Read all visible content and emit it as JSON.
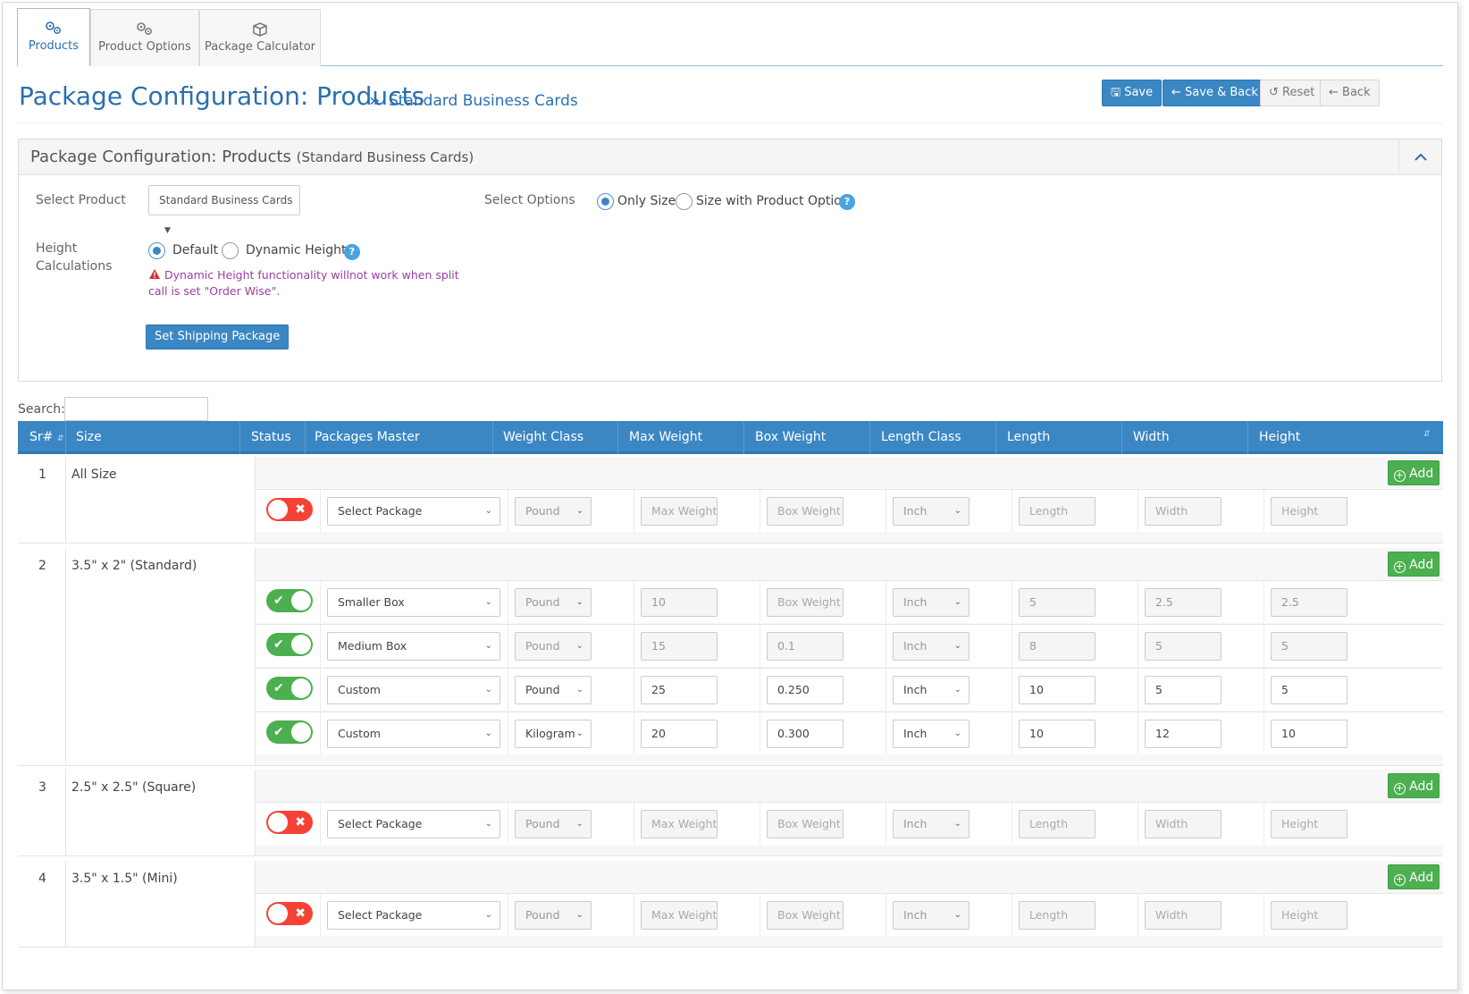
{
  "tabs": [
    {
      "label": "Products",
      "icon": "gears-icon",
      "active": true
    },
    {
      "label": "Product Options",
      "icon": "gears-icon",
      "active": false
    },
    {
      "label": "Package Calculator",
      "icon": "box-icon",
      "active": false
    }
  ],
  "header": {
    "title": "Package Configuration: Products",
    "breadcrumb_sep": "»",
    "breadcrumb": "Standard Business Cards",
    "buttons": {
      "save": "Save",
      "save_back": "Save & Back",
      "reset": "Reset",
      "back": "Back"
    }
  },
  "panel": {
    "title": "Package Configuration: Products",
    "subtitle": "(Standard Business Cards)",
    "select_product_label": "Select Product",
    "select_product_value": "Standard Business Cards",
    "select_options_label": "Select Options",
    "option_only_size": "Only Size",
    "option_size_with_product": "Size with Product Option",
    "height_calc_label_1": "Height",
    "height_calc_label_2": "Calculations",
    "height_default": "Default",
    "height_dynamic": "Dynamic Height",
    "warning_line_1": "Dynamic Height functionality willnot work when split",
    "warning_line_2": "call is set \"Order Wise\".",
    "set_shipping_button": "Set Shipping Package",
    "help": "?"
  },
  "search": {
    "label": "Search:"
  },
  "table": {
    "columns": [
      "Sr#",
      "Size",
      "Status",
      "Packages Master",
      "Weight Class",
      "Max Weight",
      "Box Weight",
      "Length Class",
      "Length",
      "Width",
      "Height"
    ],
    "add_label": "Add",
    "groups": [
      {
        "sr": "1",
        "size": "All Size",
        "rows": [
          {
            "status": "off",
            "package": "Select Package",
            "weight_class": "Pound",
            "max_weight": "Max Weight",
            "box_weight": "Box Weight",
            "length_class": "Inch",
            "length": "Length",
            "width": "Width",
            "height": "Height"
          }
        ]
      },
      {
        "sr": "2",
        "size": "3.5\" x 2\" (Standard)",
        "rows": [
          {
            "status": "on",
            "package": "Smaller Box",
            "weight_class": "Pound",
            "max_weight": "10",
            "box_weight": "Box Weight",
            "length_class": "Inch",
            "length": "5",
            "width": "2.5",
            "height": "2.5"
          },
          {
            "status": "on",
            "package": "Medium Box",
            "weight_class": "Pound",
            "max_weight": "15",
            "box_weight": "0.1",
            "length_class": "Inch",
            "length": "8",
            "width": "5",
            "height": "5"
          },
          {
            "status": "on",
            "package": "Custom",
            "weight_class": "Pound",
            "max_weight": "25",
            "box_weight": "0.250",
            "length_class": "Inch",
            "length": "10",
            "width": "5",
            "height": "5"
          },
          {
            "status": "on",
            "package": "Custom",
            "weight_class": "Kilogram",
            "max_weight": "20",
            "box_weight": "0.300",
            "length_class": "Inch",
            "length": "10",
            "width": "12",
            "height": "10"
          }
        ]
      },
      {
        "sr": "3",
        "size": "2.5\" x 2.5\" (Square)",
        "rows": [
          {
            "status": "off",
            "package": "Select Package",
            "weight_class": "Pound",
            "max_weight": "Max Weight",
            "box_weight": "Box Weight",
            "length_class": "Inch",
            "length": "Length",
            "width": "Width",
            "height": "Height"
          }
        ]
      },
      {
        "sr": "4",
        "size": "3.5\" x 1.5\" (Mini)",
        "rows": [
          {
            "status": "off",
            "package": "Select Package",
            "weight_class": "Pound",
            "max_weight": "Max Weight",
            "box_weight": "Box Weight",
            "length_class": "Inch",
            "length": "Length",
            "width": "Width",
            "height": "Height"
          }
        ]
      }
    ]
  },
  "colors": {
    "primary": "#3b87c4",
    "success": "#4caf50",
    "danger": "#f44336",
    "warning_text": "#9b3fa1"
  }
}
